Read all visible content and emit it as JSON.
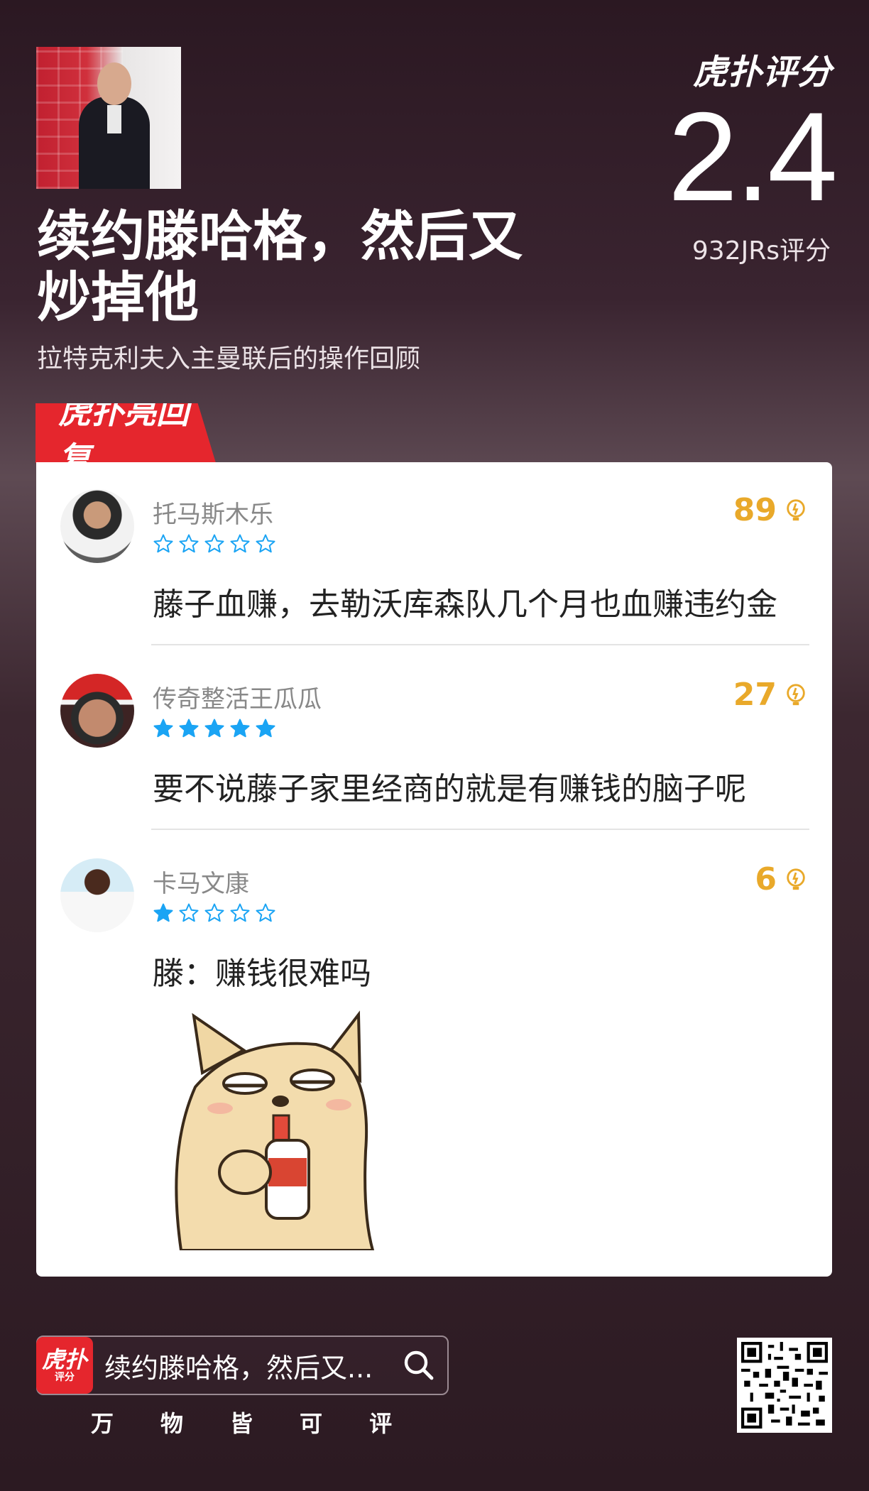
{
  "header": {
    "title": "续约滕哈格，然后又炒掉他",
    "subtitle": "拉特克利夫入主曼联后的操作回顾",
    "brand": "虎扑评分",
    "score": "2.4",
    "rating_count": "932JRs评分"
  },
  "section_tag": "虎扑亮回复",
  "replies": [
    {
      "username": "托马斯木乐",
      "rating": 0,
      "likes": "89",
      "text": "藤子血赚，去勒沃库森队几个月也血赚违约金"
    },
    {
      "username": "传奇整活王瓜瓜",
      "rating": 5,
      "likes": "27",
      "text": "要不说藤子家里经商的就是有赚钱的脑子呢"
    },
    {
      "username": "卡马文康",
      "rating": 1,
      "likes": "6",
      "text": "滕：赚钱很难吗"
    }
  ],
  "footer": {
    "app_icon_top": "虎扑",
    "app_icon_bottom": "评分",
    "search_text": "续约滕哈格，然后又...",
    "slogan": [
      "万",
      "物",
      "皆",
      "可",
      "评"
    ]
  },
  "colors": {
    "accent_red": "#e5262d",
    "star_blue": "#1aa4f4",
    "like_gold": "#e9a92a"
  }
}
